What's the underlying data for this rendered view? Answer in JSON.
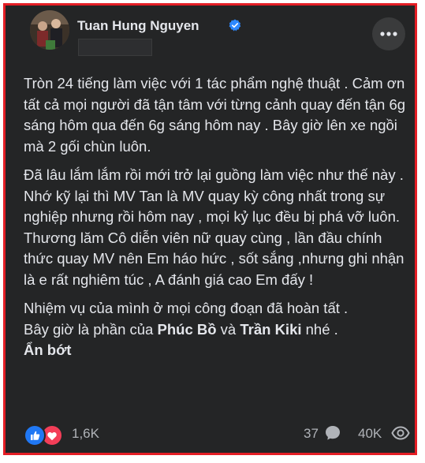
{
  "post": {
    "author": "Tuan Hung Nguyen",
    "paragraphs": [
      "Tròn 24 tiếng làm việc với 1 tác phẩm nghệ thuật . Cảm ơn tất cả mọi người đã tận tâm với từng cảnh quay đến tận 6g sáng hôm qua đến 6g sáng hôm nay . Bây giờ lên xe ngồi mà 2 gối chùn luôn.",
      "Đã lâu lắm lắm rồi mới trở lại guồng làm việc như thế này . Nhớ kỹ lại thì MV Tan là MV quay kỳ công nhất trong sự nghiệp nhưng rồi hôm nay , mọi kỷ lục đều bị phá vỡ luôn.",
      "Thương lăm Cô diễn viên nữ quay cùng , lần đầu chính thức quay MV nên Em háo hức , sốt sắng ,nhưng ghi nhận là e rất nghiêm túc , A đánh giá cao Em đấy !",
      "Nhiệm vụ của mình ở mọi công đoạn đã hoàn tất ."
    ],
    "last_line": {
      "prefix": "Bây giờ là phần của ",
      "mention_1": "Phúc Bồ",
      "between": " và ",
      "mention_2": "Trần Kiki",
      "suffix": " nhé ."
    },
    "see_less": "Ẩn bớt"
  },
  "stats": {
    "reactions": "1,6K",
    "comments": "37",
    "views": "40K"
  },
  "icons": {
    "verified": "verified-badge-icon",
    "more": "more-options-icon",
    "like": "like-reaction-icon",
    "love": "love-reaction-icon",
    "comment": "comment-icon",
    "views": "eye-icon"
  },
  "colors": {
    "frame_border": "#e41e25",
    "card_bg": "#242526",
    "text": "#e4e6eb",
    "muted": "#b0b3b8",
    "verified": "#2d88ff"
  }
}
